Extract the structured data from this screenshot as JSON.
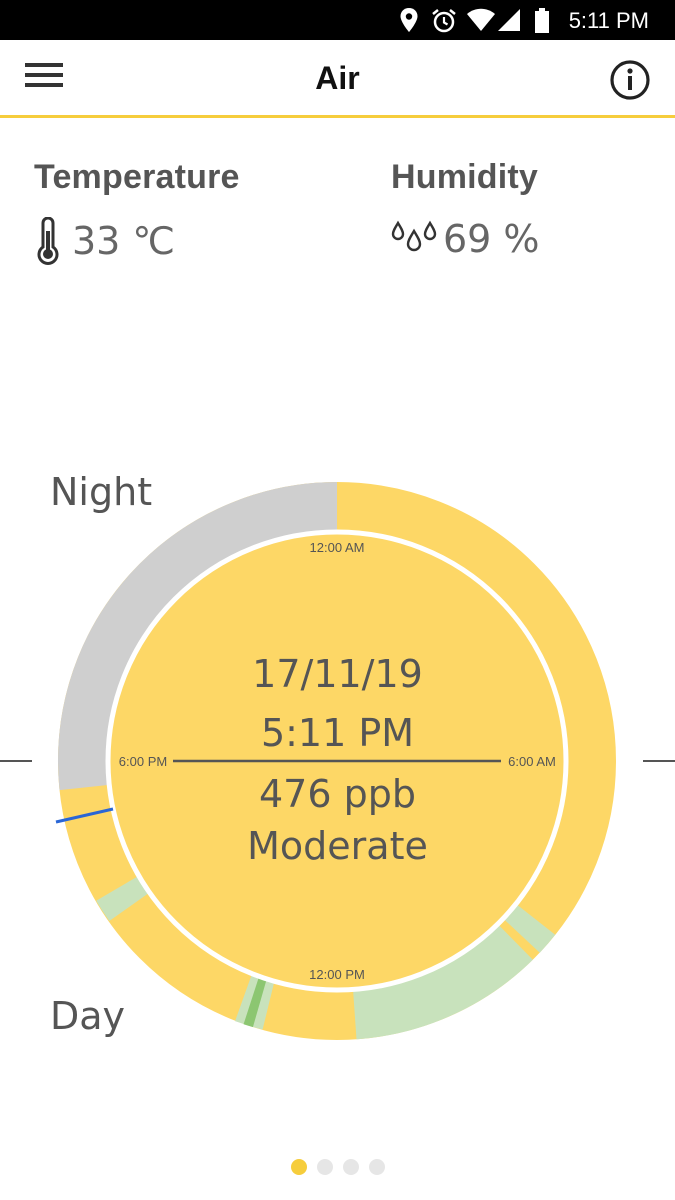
{
  "status_bar": {
    "time": "5:11 PM"
  },
  "app_bar": {
    "title": "Air"
  },
  "temperature": {
    "label": "Temperature",
    "value": "33 ℃"
  },
  "humidity": {
    "label": "Humidity",
    "value": "69 %"
  },
  "dial": {
    "night_label": "Night",
    "day_label": "Day",
    "tick_top": "12:00 AM",
    "tick_left": "6:00 PM",
    "tick_right": "6:00 AM",
    "tick_bottom": "12:00 PM",
    "date": "17/11/19",
    "time": "5:11 PM",
    "reading": "476 ppb",
    "status": "Moderate",
    "colors": {
      "moderate": "#fdd766",
      "good": "#c8e2bc",
      "very_good": "#8cc671",
      "no_data": "#cfcfcf",
      "marker": "#2a66d6"
    }
  },
  "pager": {
    "count": 4,
    "active": 0
  }
}
